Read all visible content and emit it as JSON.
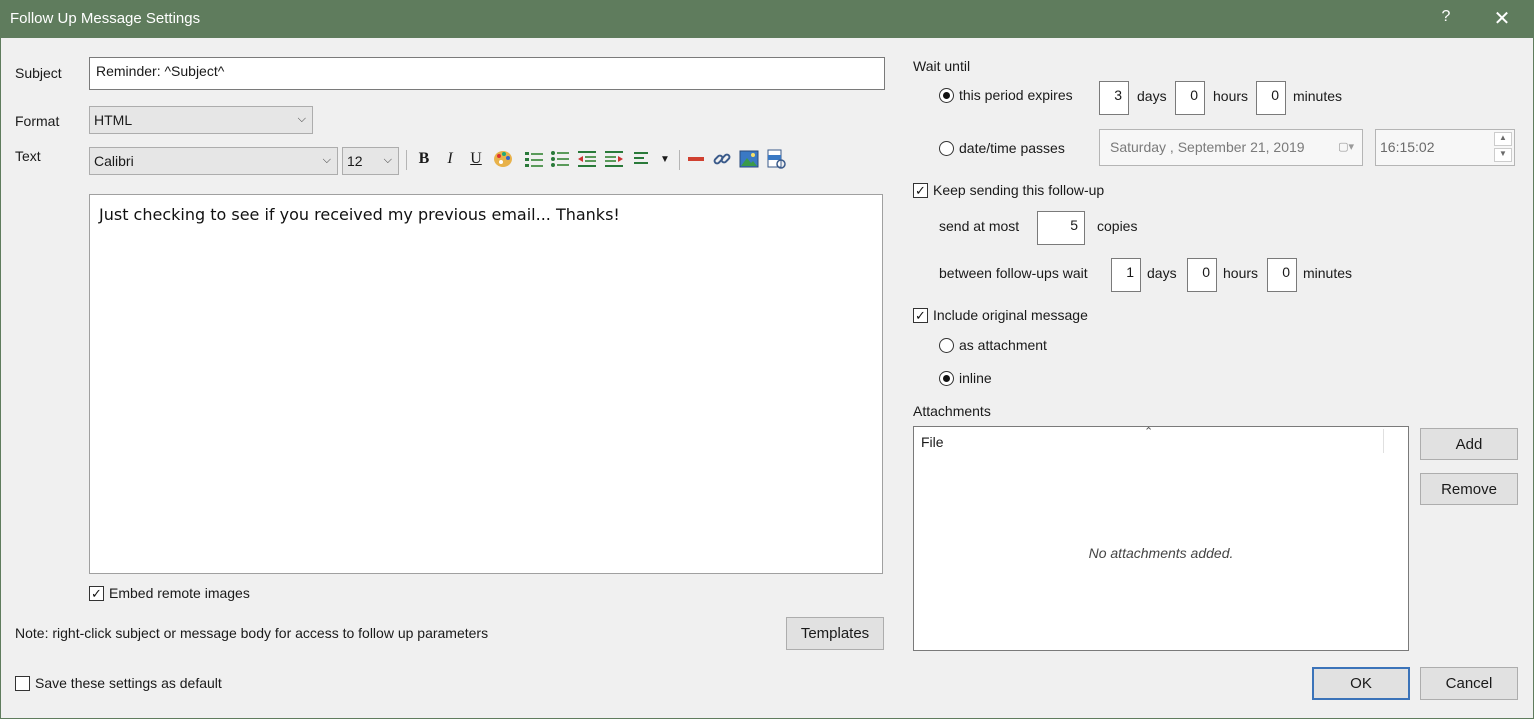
{
  "window": {
    "title": "Follow Up Message Settings",
    "help": "?",
    "close": "✕"
  },
  "left": {
    "subject_label": "Subject",
    "subject_value": "Reminder: ^Subject^",
    "format_label": "Format",
    "format_value": "HTML",
    "text_label": "Text",
    "font_value": "Calibri",
    "size_value": "12",
    "toolbar": [
      "B",
      "I",
      "U"
    ],
    "body": "Just checking to see if you received my previous email... Thanks!",
    "embed_label": "Embed remote images",
    "embed_checked": true,
    "note": "Note: right-click subject or message body for access to follow up parameters",
    "templates_button": "Templates",
    "save_default_label": "Save these settings as default",
    "save_default_checked": false
  },
  "right": {
    "wait_label": "Wait until",
    "period_label": "this period expires",
    "period_days": "3",
    "period_hours": "0",
    "period_minutes": "0",
    "days": "days",
    "hours": "hours",
    "minutes": "minutes",
    "datetime_label": "date/time passes",
    "date_value": "Saturday  , September 21, 2019",
    "time_value": "16:15:02",
    "keep_label": "Keep sending this follow-up",
    "send_at_most": "send at most",
    "copies_value": "5",
    "copies": "copies",
    "between_label": "between follow-ups wait",
    "between_days": "1",
    "between_hours": "0",
    "between_minutes": "0",
    "include_label": "Include original message",
    "as_attachment": "as attachment",
    "inline": "inline",
    "attachments_label": "Attachments",
    "file_header": "File",
    "no_attachments": "No attachments added.",
    "add_button": "Add",
    "remove_button": "Remove",
    "ok_button": "OK",
    "cancel_button": "Cancel"
  },
  "colors": {
    "titlebar": "#5f7c5d",
    "focus": "#3b73b9"
  }
}
